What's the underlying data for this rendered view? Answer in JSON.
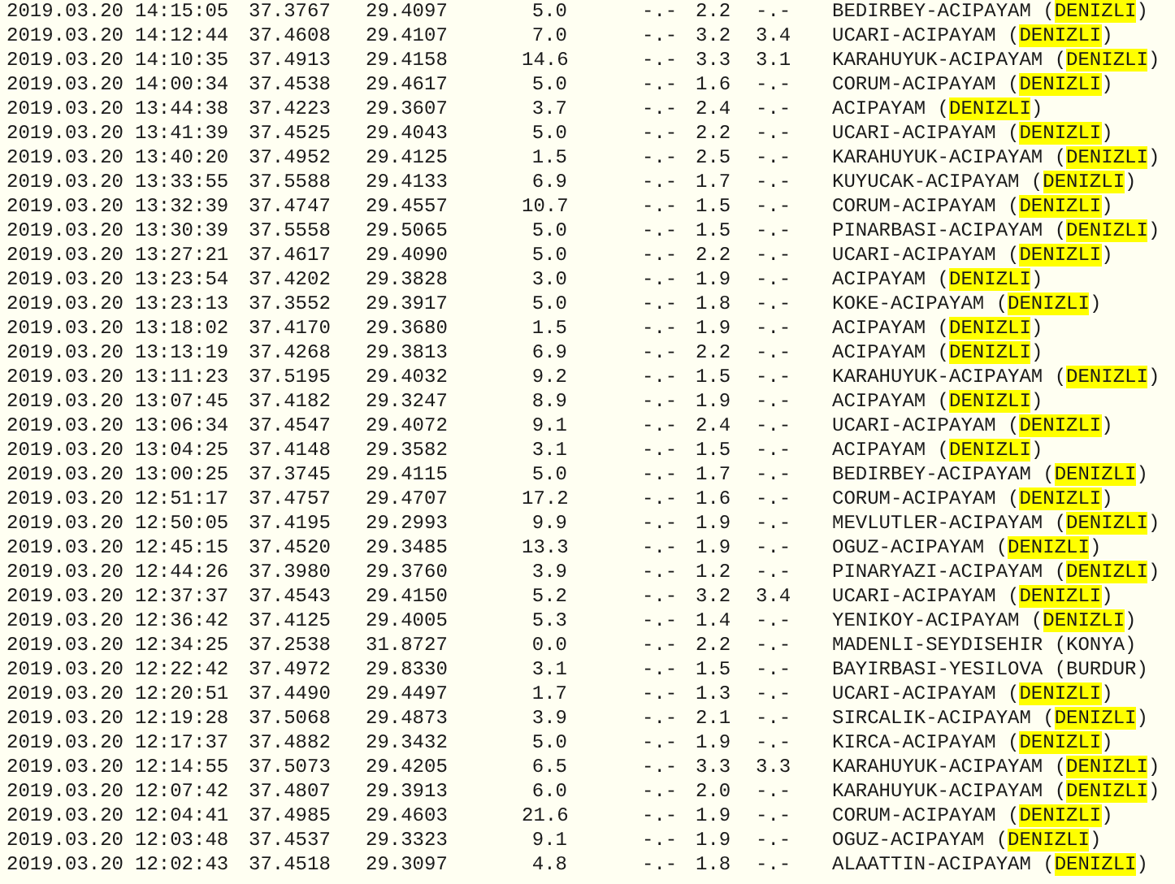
{
  "rows": [
    {
      "date": "2019.03.20",
      "time": "14:15:05",
      "latitude": "37.3767",
      "longitude": "29.4097",
      "depth": "5.0",
      "md": "-.-",
      "ml": "2.2",
      "mw": "-.-",
      "location": "BEDIRBEY-ACIPAYAM (DENIZLI)",
      "highlighted": true
    },
    {
      "date": "2019.03.20",
      "time": "14:12:44",
      "latitude": "37.4608",
      "longitude": "29.4107",
      "depth": "7.0",
      "md": "-.-",
      "ml": "3.2",
      "mw": "3.4",
      "location": "UCARI-ACIPAYAM (DENIZLI)",
      "highlighted": true
    },
    {
      "date": "2019.03.20",
      "time": "14:10:35",
      "latitude": "37.4913",
      "longitude": "29.4158",
      "depth": "14.6",
      "md": "-.-",
      "ml": "3.3",
      "mw": "3.1",
      "location": "KARAHUYUK-ACIPAYAM (DENIZLI)",
      "highlighted": true
    },
    {
      "date": "2019.03.20",
      "time": "14:00:34",
      "latitude": "37.4538",
      "longitude": "29.4617",
      "depth": "5.0",
      "md": "-.-",
      "ml": "1.6",
      "mw": "-.-",
      "location": "CORUM-ACIPAYAM (DENIZLI)",
      "highlighted": true
    },
    {
      "date": "2019.03.20",
      "time": "13:44:38",
      "latitude": "37.4223",
      "longitude": "29.3607",
      "depth": "3.7",
      "md": "-.-",
      "ml": "2.4",
      "mw": "-.-",
      "location": "ACIPAYAM (DENIZLI)",
      "highlighted": true
    },
    {
      "date": "2019.03.20",
      "time": "13:41:39",
      "latitude": "37.4525",
      "longitude": "29.4043",
      "depth": "5.0",
      "md": "-.-",
      "ml": "2.2",
      "mw": "-.-",
      "location": "UCARI-ACIPAYAM (DENIZLI)",
      "highlighted": true
    },
    {
      "date": "2019.03.20",
      "time": "13:40:20",
      "latitude": "37.4952",
      "longitude": "29.4125",
      "depth": "1.5",
      "md": "-.-",
      "ml": "2.5",
      "mw": "-.-",
      "location": "KARAHUYUK-ACIPAYAM (DENIZLI)",
      "highlighted": true
    },
    {
      "date": "2019.03.20",
      "time": "13:33:55",
      "latitude": "37.5588",
      "longitude": "29.4133",
      "depth": "6.9",
      "md": "-.-",
      "ml": "1.7",
      "mw": "-.-",
      "location": "KUYUCAK-ACIPAYAM (DENIZLI)",
      "highlighted": true
    },
    {
      "date": "2019.03.20",
      "time": "13:32:39",
      "latitude": "37.4747",
      "longitude": "29.4557",
      "depth": "10.7",
      "md": "-.-",
      "ml": "1.5",
      "mw": "-.-",
      "location": "CORUM-ACIPAYAM (DENIZLI)",
      "highlighted": true
    },
    {
      "date": "2019.03.20",
      "time": "13:30:39",
      "latitude": "37.5558",
      "longitude": "29.5065",
      "depth": "5.0",
      "md": "-.-",
      "ml": "1.5",
      "mw": "-.-",
      "location": "PINARBASI-ACIPAYAM (DENIZLI)",
      "highlighted": true
    },
    {
      "date": "2019.03.20",
      "time": "13:27:21",
      "latitude": "37.4617",
      "longitude": "29.4090",
      "depth": "5.0",
      "md": "-.-",
      "ml": "2.2",
      "mw": "-.-",
      "location": "UCARI-ACIPAYAM (DENIZLI)",
      "highlighted": true
    },
    {
      "date": "2019.03.20",
      "time": "13:23:54",
      "latitude": "37.4202",
      "longitude": "29.3828",
      "depth": "3.0",
      "md": "-.-",
      "ml": "1.9",
      "mw": "-.-",
      "location": "ACIPAYAM (DENIZLI)",
      "highlighted": true
    },
    {
      "date": "2019.03.20",
      "time": "13:23:13",
      "latitude": "37.3552",
      "longitude": "29.3917",
      "depth": "5.0",
      "md": "-.-",
      "ml": "1.8",
      "mw": "-.-",
      "location": "KOKE-ACIPAYAM (DENIZLI)",
      "highlighted": true
    },
    {
      "date": "2019.03.20",
      "time": "13:18:02",
      "latitude": "37.4170",
      "longitude": "29.3680",
      "depth": "1.5",
      "md": "-.-",
      "ml": "1.9",
      "mw": "-.-",
      "location": "ACIPAYAM (DENIZLI)",
      "highlighted": true
    },
    {
      "date": "2019.03.20",
      "time": "13:13:19",
      "latitude": "37.4268",
      "longitude": "29.3813",
      "depth": "6.9",
      "md": "-.-",
      "ml": "2.2",
      "mw": "-.-",
      "location": "ACIPAYAM (DENIZLI)",
      "highlighted": true
    },
    {
      "date": "2019.03.20",
      "time": "13:11:23",
      "latitude": "37.5195",
      "longitude": "29.4032",
      "depth": "9.2",
      "md": "-.-",
      "ml": "1.5",
      "mw": "-.-",
      "location": "KARAHUYUK-ACIPAYAM (DENIZLI)",
      "highlighted": true
    },
    {
      "date": "2019.03.20",
      "time": "13:07:45",
      "latitude": "37.4182",
      "longitude": "29.3247",
      "depth": "8.9",
      "md": "-.-",
      "ml": "1.9",
      "mw": "-.-",
      "location": "ACIPAYAM (DENIZLI)",
      "highlighted": true
    },
    {
      "date": "2019.03.20",
      "time": "13:06:34",
      "latitude": "37.4547",
      "longitude": "29.4072",
      "depth": "9.1",
      "md": "-.-",
      "ml": "2.4",
      "mw": "-.-",
      "location": "UCARI-ACIPAYAM (DENIZLI)",
      "highlighted": true
    },
    {
      "date": "2019.03.20",
      "time": "13:04:25",
      "latitude": "37.4148",
      "longitude": "29.3582",
      "depth": "3.1",
      "md": "-.-",
      "ml": "1.5",
      "mw": "-.-",
      "location": "ACIPAYAM (DENIZLI)",
      "highlighted": true
    },
    {
      "date": "2019.03.20",
      "time": "13:00:25",
      "latitude": "37.3745",
      "longitude": "29.4115",
      "depth": "5.0",
      "md": "-.-",
      "ml": "1.7",
      "mw": "-.-",
      "location": "BEDIRBEY-ACIPAYAM (DENIZLI)",
      "highlighted": true
    },
    {
      "date": "2019.03.20",
      "time": "12:51:17",
      "latitude": "37.4757",
      "longitude": "29.4707",
      "depth": "17.2",
      "md": "-.-",
      "ml": "1.6",
      "mw": "-.-",
      "location": "CORUM-ACIPAYAM (DENIZLI)",
      "highlighted": true
    },
    {
      "date": "2019.03.20",
      "time": "12:50:05",
      "latitude": "37.4195",
      "longitude": "29.2993",
      "depth": "9.9",
      "md": "-.-",
      "ml": "1.9",
      "mw": "-.-",
      "location": "MEVLUTLER-ACIPAYAM (DENIZLI)",
      "highlighted": true
    },
    {
      "date": "2019.03.20",
      "time": "12:45:15",
      "latitude": "37.4520",
      "longitude": "29.3485",
      "depth": "13.3",
      "md": "-.-",
      "ml": "1.9",
      "mw": "-.-",
      "location": "OGUZ-ACIPAYAM (DENIZLI)",
      "highlighted": true
    },
    {
      "date": "2019.03.20",
      "time": "12:44:26",
      "latitude": "37.3980",
      "longitude": "29.3760",
      "depth": "3.9",
      "md": "-.-",
      "ml": "1.2",
      "mw": "-.-",
      "location": "PINARYAZI-ACIPAYAM (DENIZLI)",
      "highlighted": true
    },
    {
      "date": "2019.03.20",
      "time": "12:37:37",
      "latitude": "37.4543",
      "longitude": "29.4150",
      "depth": "5.2",
      "md": "-.-",
      "ml": "3.2",
      "mw": "3.4",
      "location": "UCARI-ACIPAYAM (DENIZLI)",
      "highlighted": true
    },
    {
      "date": "2019.03.20",
      "time": "12:36:42",
      "latitude": "37.4125",
      "longitude": "29.4005",
      "depth": "5.3",
      "md": "-.-",
      "ml": "1.4",
      "mw": "-.-",
      "location": "YENIKOY-ACIPAYAM (DENIZLI)",
      "highlighted": true
    },
    {
      "date": "2019.03.20",
      "time": "12:34:25",
      "latitude": "37.2538",
      "longitude": "31.8727",
      "depth": "0.0",
      "md": "-.-",
      "ml": "2.2",
      "mw": "-.-",
      "location": "MADENLI-SEYDISEHIR (KONYA)",
      "highlighted": false
    },
    {
      "date": "2019.03.20",
      "time": "12:22:42",
      "latitude": "37.4972",
      "longitude": "29.8330",
      "depth": "3.1",
      "md": "-.-",
      "ml": "1.5",
      "mw": "-.-",
      "location": "BAYIRBASI-YESILOVA (BURDUR)",
      "highlighted": false
    },
    {
      "date": "2019.03.20",
      "time": "12:20:51",
      "latitude": "37.4490",
      "longitude": "29.4497",
      "depth": "1.7",
      "md": "-.-",
      "ml": "1.3",
      "mw": "-.-",
      "location": "UCARI-ACIPAYAM (DENIZLI)",
      "highlighted": true
    },
    {
      "date": "2019.03.20",
      "time": "12:19:28",
      "latitude": "37.5068",
      "longitude": "29.4873",
      "depth": "3.9",
      "md": "-.-",
      "ml": "2.1",
      "mw": "-.-",
      "location": "SIRCALIK-ACIPAYAM (DENIZLI)",
      "highlighted": true
    },
    {
      "date": "2019.03.20",
      "time": "12:17:37",
      "latitude": "37.4882",
      "longitude": "29.3432",
      "depth": "5.0",
      "md": "-.-",
      "ml": "1.9",
      "mw": "-.-",
      "location": "KIRCA-ACIPAYAM (DENIZLI)",
      "highlighted": true
    },
    {
      "date": "2019.03.20",
      "time": "12:14:55",
      "latitude": "37.5073",
      "longitude": "29.4205",
      "depth": "6.5",
      "md": "-.-",
      "ml": "3.3",
      "mw": "3.3",
      "location": "KARAHUYUK-ACIPAYAM (DENIZLI)",
      "highlighted": true
    },
    {
      "date": "2019.03.20",
      "time": "12:07:42",
      "latitude": "37.4807",
      "longitude": "29.3913",
      "depth": "6.0",
      "md": "-.-",
      "ml": "2.0",
      "mw": "-.-",
      "location": "KARAHUYUK-ACIPAYAM (DENIZLI)",
      "highlighted": true
    },
    {
      "date": "2019.03.20",
      "time": "12:04:41",
      "latitude": "37.4985",
      "longitude": "29.4603",
      "depth": "21.6",
      "md": "-.-",
      "ml": "1.9",
      "mw": "-.-",
      "location": "CORUM-ACIPAYAM (DENIZLI)",
      "highlighted": true
    },
    {
      "date": "2019.03.20",
      "time": "12:03:48",
      "latitude": "37.4537",
      "longitude": "29.3323",
      "depth": "9.1",
      "md": "-.-",
      "ml": "1.9",
      "mw": "-.-",
      "location": "OGUZ-ACIPAYAM (DENIZLI)",
      "highlighted": true
    },
    {
      "date": "2019.03.20",
      "time": "12:02:43",
      "latitude": "37.4518",
      "longitude": "29.3097",
      "depth": "4.8",
      "md": "-.-",
      "ml": "1.8",
      "mw": "-.-",
      "location": "ALAATTIN-ACIPAYAM (DENIZLI)",
      "highlighted": true
    }
  ]
}
